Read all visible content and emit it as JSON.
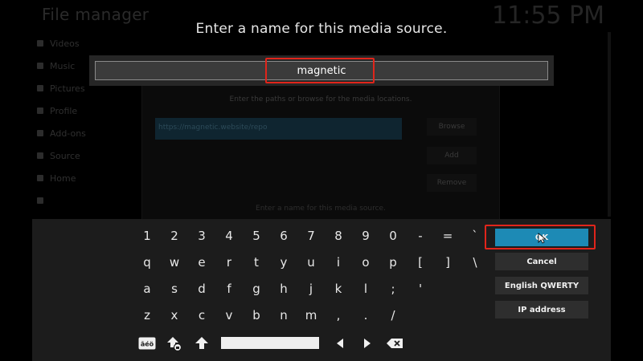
{
  "background": {
    "window_title": "File manager",
    "clock": "11:55 PM",
    "list_items": [
      "Videos",
      "Music",
      "Pictures",
      "Profile",
      "Add-ons",
      "Source",
      "Home",
      ""
    ]
  },
  "source_dialog": {
    "hint": "Enter the paths or browse for the media locations.",
    "path_value": "https://magnetic.website/repo",
    "browse_label": "Browse",
    "add_label": "Add",
    "remove_label": "Remove",
    "bottom_hint": "Enter a name for this media source."
  },
  "dialog": {
    "prompt": "Enter a name for this media source.",
    "input_value": "magnetic"
  },
  "keyboard": {
    "rows": [
      [
        "1",
        "2",
        "3",
        "4",
        "5",
        "6",
        "7",
        "8",
        "9",
        "0",
        "-",
        "=",
        "`"
      ],
      [
        "q",
        "w",
        "e",
        "r",
        "t",
        "y",
        "u",
        "i",
        "o",
        "p",
        "[",
        "]",
        "\\"
      ],
      [
        "a",
        "s",
        "d",
        "f",
        "g",
        "h",
        "j",
        "k",
        "l",
        ";",
        "'"
      ],
      [
        "z",
        "x",
        "c",
        "v",
        "b",
        "n",
        "m",
        ",",
        ".",
        "/"
      ]
    ],
    "buttons": {
      "ok": "OK",
      "cancel": "Cancel",
      "layout": "English QWERTY",
      "ip_address": "IP address"
    },
    "icons": {
      "symbols": "symbols-icon",
      "shift_lock": "shift-lock-icon",
      "shift": "shift-icon",
      "left": "arrow-left-icon",
      "right": "arrow-right-icon",
      "backspace": "backspace-icon"
    }
  },
  "colors": {
    "ok_button": "#1d8ab5",
    "highlight": "#e0251b",
    "panel": "#1c1c1c"
  }
}
